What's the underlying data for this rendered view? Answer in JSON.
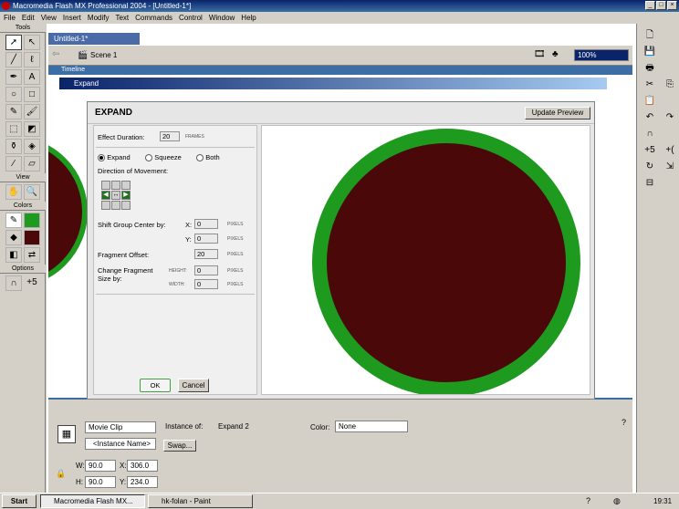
{
  "app": {
    "title": "Macromedia Flash MX Professional 2004 - [Untitled-1*]",
    "menu": [
      "File",
      "Edit",
      "View",
      "Insert",
      "Modify",
      "Text",
      "Commands",
      "Control",
      "Window",
      "Help"
    ]
  },
  "tools_panel": {
    "header": "Tools",
    "tools": [
      "arrow-icon",
      "subselect-icon",
      "line-icon",
      "lasso-icon",
      "pen-icon",
      "text-icon",
      "oval-icon",
      "rectangle-icon",
      "pencil-icon",
      "brush-icon",
      "free-transform-icon",
      "fill-transform-icon",
      "ink-bottle-icon",
      "paint-bucket-icon",
      "eyedropper-icon",
      "eraser-icon"
    ],
    "view_label": "View",
    "colors_label": "Colors",
    "options_label": "Options"
  },
  "document": {
    "tab": "Untitled-1*",
    "scene": "Scene 1",
    "zoom": "100%",
    "timeline_label": "Timeline"
  },
  "dialog": {
    "window_title": "Expand",
    "heading": "EXPAND",
    "update_preview": "Update Preview",
    "effect_duration_label": "Effect Duration:",
    "effect_duration": "20",
    "frames_unit": "FRAMES",
    "modes": [
      {
        "label": "Expand",
        "checked": true
      },
      {
        "label": "Squeeze",
        "checked": false
      },
      {
        "label": "Both",
        "checked": false
      }
    ],
    "direction_label": "Direction of Movement:",
    "shift_label": "Shift Group Center by:",
    "x_label": "X:",
    "x_value": "0",
    "y_label": "Y:",
    "y_value": "0",
    "pixels_unit": "PIXELS",
    "fragment_offset_label": "Fragment Offset:",
    "fragment_offset": "20",
    "change_fragment_label_1": "Change Fragment",
    "change_fragment_label_2": "Size by:",
    "height_label": "HEIGHT:",
    "height_value": "0",
    "width_label": "WIDTH:",
    "width_value": "0",
    "ok": "OK",
    "cancel": "Cancel",
    "preview_colors": {
      "ring": "#1e9a1e",
      "fill": "#4a0808"
    }
  },
  "properties": {
    "symbol_type": "Movie Clip",
    "instance_name_placeholder": "<Instance Name>",
    "instance_of_label": "Instance of:",
    "instance_of_value": "Expand 2",
    "swap": "Swap...",
    "color_label": "Color:",
    "color_value": "None",
    "w_label": "W:",
    "w_value": "90.0",
    "h_label": "H:",
    "h_value": "90.0",
    "x_label": "X:",
    "x_value": "306.0",
    "y_label": "Y:",
    "y_value": "234.0"
  },
  "taskbar": {
    "start": "Start",
    "tasks": [
      {
        "label": "Macromedia Flash MX...",
        "active": true
      },
      {
        "label": "hk-folan - Paint",
        "active": false
      }
    ],
    "clock": "19:31"
  }
}
